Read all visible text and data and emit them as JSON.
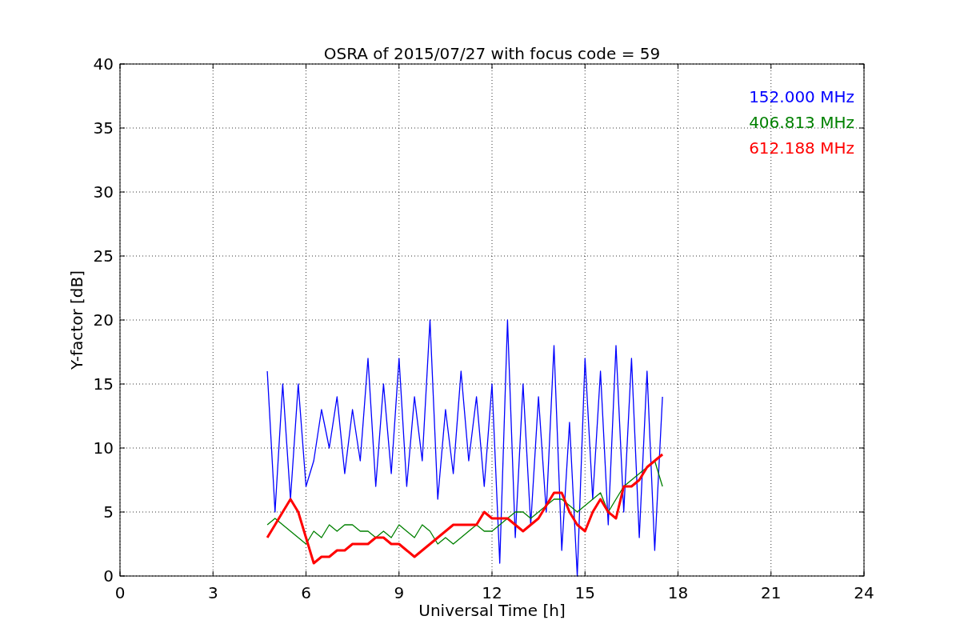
{
  "figure": {
    "chart_data": {
      "type": "line",
      "title": "OSRA of 2015/07/27 with focus code = 59",
      "xlabel": "Universal Time [h]",
      "ylabel": "Y-factor [dB]",
      "x": [
        4.75,
        5,
        5.25,
        5.5,
        5.75,
        6,
        6.25,
        6.5,
        6.75,
        7,
        7.25,
        7.5,
        7.75,
        8,
        8.25,
        8.5,
        8.75,
        9,
        9.25,
        9.5,
        9.75,
        10,
        10.25,
        10.5,
        10.75,
        11,
        11.25,
        11.5,
        11.75,
        12,
        12.25,
        12.5,
        12.75,
        13,
        13.25,
        13.5,
        13.75,
        14,
        14.25,
        14.5,
        14.75,
        15,
        15.25,
        15.5,
        15.75,
        16,
        16.25,
        16.5,
        16.75,
        17,
        17.25,
        17.5
      ],
      "series": [
        {
          "name": "152.000 MHz",
          "color": "#0000ff",
          "values": [
            16,
            5,
            15,
            6,
            15,
            7,
            9,
            13,
            10,
            14,
            8,
            13,
            9,
            17,
            7,
            15,
            8,
            17,
            7,
            14,
            9,
            20,
            6,
            13,
            8,
            16,
            9,
            14,
            7,
            15,
            1,
            20,
            3,
            15,
            4,
            14,
            5,
            18,
            2,
            12,
            0,
            17,
            6,
            16,
            4,
            18,
            5,
            17,
            3,
            16,
            2,
            14
          ]
        },
        {
          "name": "406.813 MHz",
          "color": "#008000",
          "values": [
            4,
            4.5,
            4,
            3.5,
            3,
            2.5,
            3.5,
            3,
            4,
            3.5,
            4,
            4,
            3.5,
            3.5,
            3,
            3.5,
            3,
            4,
            3.5,
            3,
            4,
            3.5,
            2.5,
            3,
            2.5,
            3,
            3.5,
            4,
            3.5,
            3.5,
            4,
            4.5,
            5,
            5,
            4.5,
            5,
            5.5,
            6,
            6,
            5.5,
            5,
            5.5,
            6,
            6.5,
            5,
            6,
            7,
            7.5,
            8,
            8.5,
            9,
            7
          ]
        },
        {
          "name": "612.188 MHz",
          "color": "#ff0000",
          "values": [
            3,
            4,
            5,
            6,
            5,
            3,
            1,
            1.5,
            1.5,
            2,
            2,
            2.5,
            2.5,
            2.5,
            3,
            3,
            2.5,
            2.5,
            2,
            1.5,
            2,
            2.5,
            3,
            3.5,
            4,
            4,
            4,
            4,
            5,
            4.5,
            4.5,
            4.5,
            4,
            3.5,
            4,
            4.5,
            5.5,
            6.5,
            6.5,
            5,
            4,
            3.5,
            5,
            6,
            5,
            4.5,
            7,
            7,
            7.5,
            8.5,
            9,
            9.5
          ]
        }
      ],
      "xlim": [
        0,
        24
      ],
      "ylim": [
        0,
        40
      ],
      "xticks": [
        0,
        3,
        6,
        9,
        12,
        15,
        18,
        21,
        24
      ],
      "yticks": [
        0,
        5,
        10,
        15,
        20,
        25,
        30,
        35,
        40
      ],
      "grid": true
    }
  }
}
